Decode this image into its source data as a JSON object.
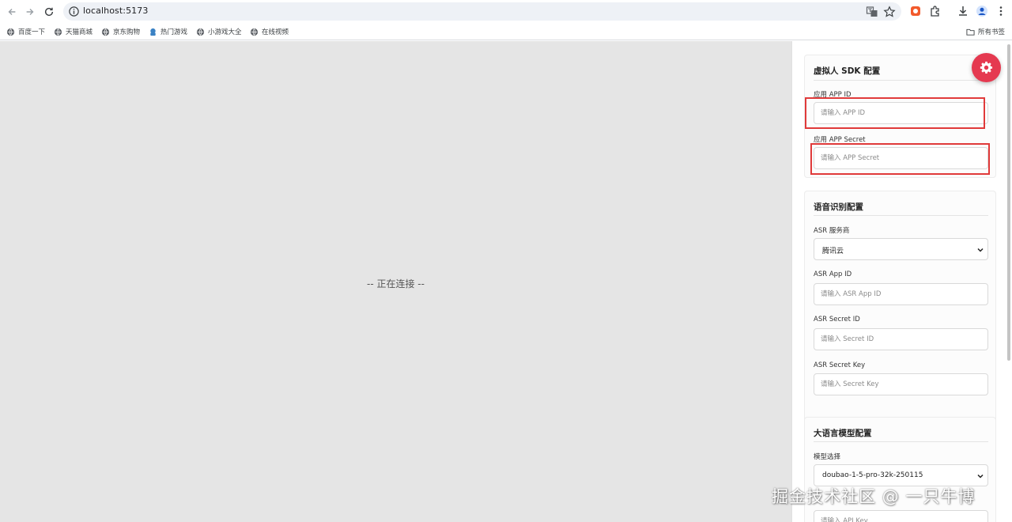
{
  "browser": {
    "url": "localhost:5173",
    "bookmarks": [
      "百度一下",
      "天猫商城",
      "京东购物",
      "热门游戏",
      "小游戏大全",
      "在线视频"
    ],
    "all_bookmarks_label": "所有书签"
  },
  "stage": {
    "status_text": "-- 正在连接 --"
  },
  "sdk_config": {
    "title": "虚拟人 SDK 配置",
    "app_id_label": "应用 APP ID",
    "app_id_placeholder": "请输入 APP ID",
    "app_secret_label": "应用 APP Secret",
    "app_secret_placeholder": "请输入 APP Secret"
  },
  "asr_config": {
    "title": "语音识别配置",
    "provider_label": "ASR 服务商",
    "provider_value": "腾讯云",
    "app_id_label": "ASR App ID",
    "app_id_placeholder": "请输入 ASR App ID",
    "secret_id_label": "ASR Secret ID",
    "secret_id_placeholder": "请输入 Secret ID",
    "secret_key_label": "ASR Secret Key",
    "secret_key_placeholder": "请输入 Secret Key"
  },
  "llm_config": {
    "title": "大语言模型配置",
    "model_label": "模型选择",
    "model_value": "doubao-1-5-pro-32k-250115",
    "api_key_placeholder": "请输入 API Key"
  },
  "watermark": "掘金技术社区 @ 一只牛博",
  "colors": {
    "accent": "#e53950",
    "highlight": "#e03a3a",
    "stage_bg": "#e5e5e5"
  },
  "icons": [
    "back-arrow-icon",
    "forward-arrow-icon",
    "reload-icon",
    "info-icon",
    "translate-icon",
    "star-icon",
    "extension-icon",
    "puzzle-icon",
    "download-icon",
    "profile-icon",
    "menu-icon",
    "globe-icon",
    "folder-icon",
    "gear-icon",
    "chevron-down-icon"
  ]
}
